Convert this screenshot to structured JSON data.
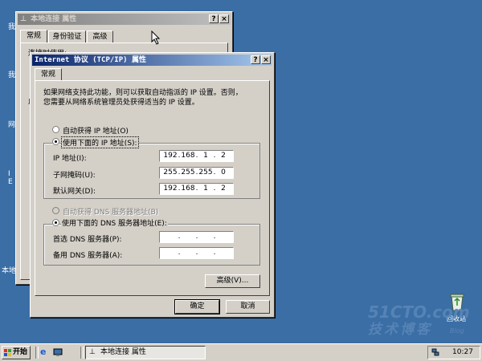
{
  "desktop": {
    "left_labels": [
      "我",
      "我",
      "网",
      "I",
      "E",
      "本地"
    ],
    "recycle_bin_label": "回收站",
    "watermark_line1": "51CTO.com",
    "watermark_line2": "技术博客",
    "watermark_blog": "Blog"
  },
  "back_window": {
    "title": "本地连接 属性",
    "tabs": [
      "常规",
      "身份验证",
      "高级"
    ],
    "connect_label": "连接时使用:",
    "side_char": "此"
  },
  "dialog": {
    "title": "Internet 协议 (TCP/IP) 属性",
    "help_btn": "?",
    "close_btn": "×",
    "tab": "常规",
    "description": "如果网络支持此功能，则可以获取自动指派的 IP 设置。否则，您需要从网络系统管理员处获得适当的 IP 设置。",
    "auto_ip_label": "自动获得 IP 地址(O)",
    "manual_ip_label": "使用下面的 IP 地址(S):",
    "ip_label": "IP 地址(I):",
    "subnet_label": "子网掩码(U):",
    "gateway_label": "默认网关(D):",
    "ip_address": [
      "192",
      "168",
      "1",
      "2"
    ],
    "subnet_mask": [
      "255",
      "255",
      "255",
      "0"
    ],
    "gateway": [
      "192",
      "168",
      "1",
      "2"
    ],
    "auto_dns_label": "自动获得 DNS 服务器地址(B)",
    "manual_dns_label": "使用下面的 DNS 服务器地址(E):",
    "preferred_dns_label": "首选 DNS 服务器(P):",
    "alternate_dns_label": "备用 DNS 服务器(A):",
    "preferred_dns": [
      "",
      "",
      "",
      ""
    ],
    "alternate_dns": [
      "",
      "",
      "",
      ""
    ],
    "advanced_button": "高级(V)...",
    "ok_button": "确定",
    "cancel_button": "取消",
    "selected_ip_mode": "manual",
    "selected_dns_mode": "manual"
  },
  "taskbar": {
    "start_label": "开始",
    "task_label": "本地连接 属性",
    "clock": "10:27"
  },
  "colors": {
    "desktop": "#3a6ea5",
    "title_active": "#0a246a",
    "face": "#d4d0c8"
  }
}
